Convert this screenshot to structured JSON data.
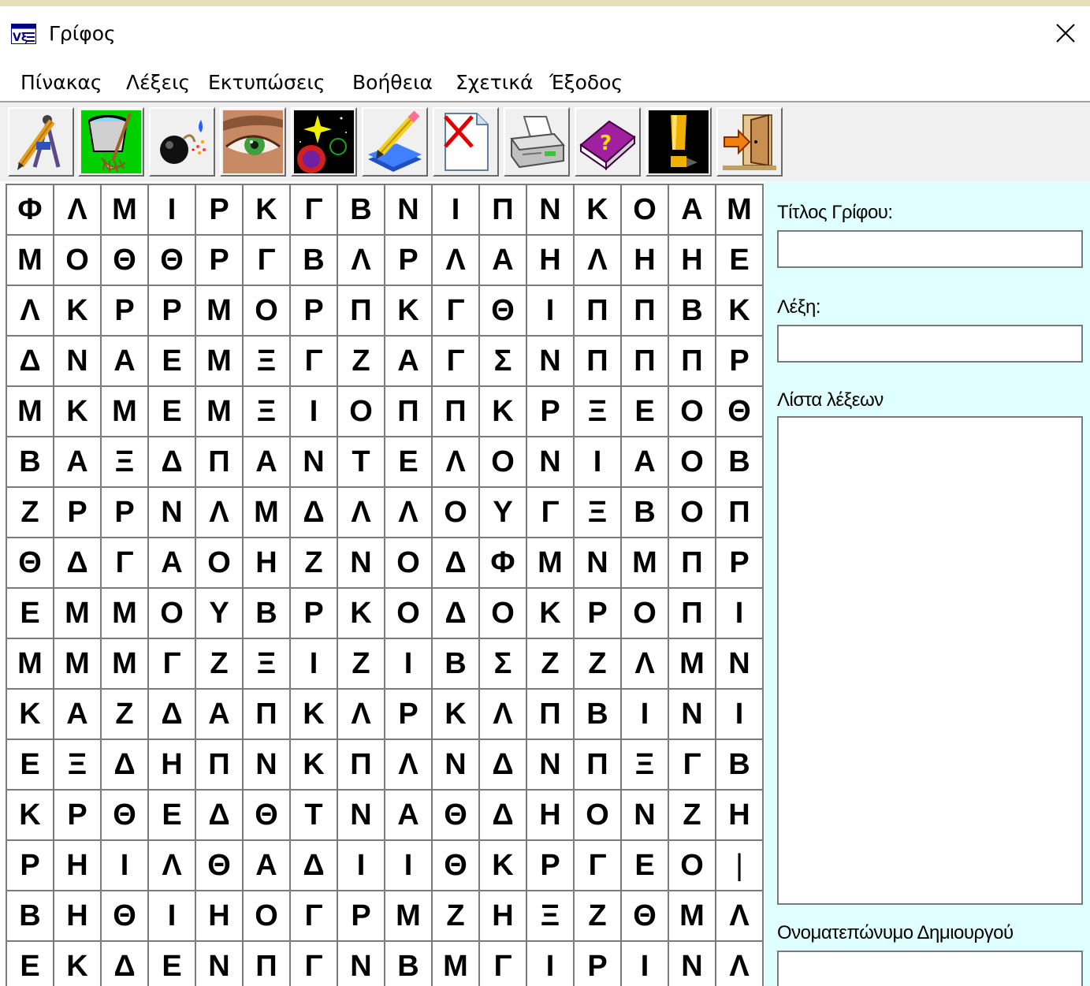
{
  "window": {
    "title": "Γρίφος",
    "close_glyph": "✕"
  },
  "menu": [
    {
      "label": "Πίνακας"
    },
    {
      "label": "Λέξεις"
    },
    {
      "label": "Εκτυπώσεις"
    },
    {
      "label": "Βοήθεια"
    },
    {
      "label": "Σχετικά"
    },
    {
      "label": "Έξοδος"
    }
  ],
  "toolbar": [
    {
      "icon": "pencil-compass-icon"
    },
    {
      "icon": "bucket-mop-icon"
    },
    {
      "icon": "bomb-icon"
    },
    {
      "icon": "eye-icon"
    },
    {
      "icon": "space-star-icon"
    },
    {
      "icon": "edit-pencil-icon"
    },
    {
      "icon": "delete-document-icon"
    },
    {
      "icon": "printer-icon"
    },
    {
      "icon": "help-book-icon"
    },
    {
      "icon": "exclamation-icon"
    },
    {
      "icon": "exit-door-icon"
    }
  ],
  "grid": {
    "rows": [
      [
        "Φ",
        "Λ",
        "Μ",
        "Ι",
        "Ρ",
        "Κ",
        "Γ",
        "Β",
        "Ν",
        "Ι",
        "Π",
        "Ν",
        "Κ",
        "Ο",
        "Α",
        "Μ"
      ],
      [
        "Μ",
        "Ο",
        "Θ",
        "Θ",
        "Ρ",
        "Γ",
        "Β",
        "Λ",
        "Ρ",
        "Λ",
        "Α",
        "Η",
        "Λ",
        "Η",
        "Η",
        "Ε"
      ],
      [
        "Λ",
        "Κ",
        "Ρ",
        "Ρ",
        "Μ",
        "Ο",
        "Ρ",
        "Π",
        "Κ",
        "Γ",
        "Θ",
        "Ι",
        "Π",
        "Π",
        "Β",
        "Κ"
      ],
      [
        "Δ",
        "Ν",
        "Α",
        "Ε",
        "Μ",
        "Ξ",
        "Γ",
        "Ζ",
        "Α",
        "Γ",
        "Σ",
        "Ν",
        "Π",
        "Π",
        "Π",
        "Ρ"
      ],
      [
        "Μ",
        "Κ",
        "Μ",
        "Ε",
        "Μ",
        "Ξ",
        "Ι",
        "Ο",
        "Π",
        "Π",
        "Κ",
        "Ρ",
        "Ξ",
        "Ε",
        "Ο",
        "Θ"
      ],
      [
        "Β",
        "Α",
        "Ξ",
        "Δ",
        "Π",
        "Α",
        "Ν",
        "Τ",
        "Ε",
        "Λ",
        "Ο",
        "Ν",
        "Ι",
        "Α",
        "Ο",
        "Β"
      ],
      [
        "Ζ",
        "Ρ",
        "Ρ",
        "Ν",
        "Λ",
        "Μ",
        "Δ",
        "Λ",
        "Λ",
        "Ο",
        "Υ",
        "Γ",
        "Ξ",
        "Β",
        "Ο",
        "Π"
      ],
      [
        "Θ",
        "Δ",
        "Γ",
        "Α",
        "Ο",
        "Η",
        "Ζ",
        "Ν",
        "Ο",
        "Δ",
        "Φ",
        "Μ",
        "Ν",
        "Μ",
        "Π",
        "Ρ"
      ],
      [
        "Ε",
        "Μ",
        "Μ",
        "Ο",
        "Υ",
        "Β",
        "Ρ",
        "Κ",
        "Ο",
        "Δ",
        "Ο",
        "Κ",
        "Ρ",
        "Ο",
        "Π",
        "Ι"
      ],
      [
        "Μ",
        "Μ",
        "Μ",
        "Γ",
        "Ζ",
        "Ξ",
        "Ι",
        "Ζ",
        "Ι",
        "Β",
        "Σ",
        "Ζ",
        "Ζ",
        "Λ",
        "Μ",
        "Ν"
      ],
      [
        "Κ",
        "Α",
        "Ζ",
        "Δ",
        "Α",
        "Π",
        "Κ",
        "Λ",
        "Ρ",
        "Κ",
        "Λ",
        "Π",
        "Β",
        "Ι",
        "Ν",
        "Ι"
      ],
      [
        "Ε",
        "Ξ",
        "Δ",
        "Η",
        "Π",
        "Ν",
        "Κ",
        "Π",
        "Λ",
        "Ν",
        "Δ",
        "Ν",
        "Π",
        "Ξ",
        "Γ",
        "Β"
      ],
      [
        "Κ",
        "Ρ",
        "Θ",
        "Ε",
        "Δ",
        "Θ",
        "Τ",
        "Ν",
        "Α",
        "Θ",
        "Δ",
        "Η",
        "Ο",
        "Ν",
        "Ζ",
        "Η"
      ],
      [
        "Ρ",
        "Η",
        "Ι",
        "Λ",
        "Θ",
        "Α",
        "Δ",
        "Ι",
        "Ι",
        "Θ",
        "Κ",
        "Ρ",
        "Γ",
        "Ε",
        "Ο",
        "|"
      ],
      [
        "Β",
        "Η",
        "Θ",
        "Ι",
        "Η",
        "Ο",
        "Γ",
        "Ρ",
        "Μ",
        "Ζ",
        "Η",
        "Ξ",
        "Ζ",
        "Θ",
        "Μ",
        "Λ"
      ],
      [
        "Ε",
        "Κ",
        "Δ",
        "Ε",
        "Ν",
        "Π",
        "Γ",
        "Ν",
        "Β",
        "Μ",
        "Γ",
        "Ι",
        "Ρ",
        "Ι",
        "Ν",
        "Λ"
      ]
    ]
  },
  "panel": {
    "title_label": "Τίτλος Γρίφου:",
    "title_value": "",
    "word_label": "Λέξη:",
    "word_value": "",
    "list_label": "Λίστα λέξεων",
    "author_label": "Ονοματεπώνυμο Δημιουργού",
    "author_value": ""
  },
  "colors": {
    "panel_bg": "#e0ffff",
    "desktop_bg": "#e6e0ba",
    "toolbar_bg": "#f0f0f0"
  }
}
